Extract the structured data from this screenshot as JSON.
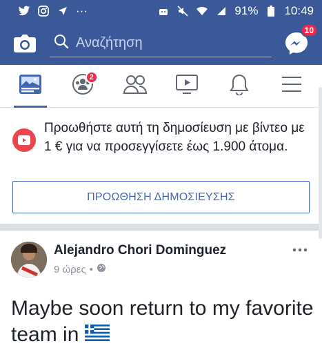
{
  "status_bar": {
    "left_icons": [
      "twitter-icon",
      "instagram-icon",
      "navigation-arrow-icon",
      "more-dots-icon"
    ],
    "battery_percent": "91%",
    "time": "10:49"
  },
  "header": {
    "search_placeholder": "Αναζήτηση",
    "messenger_badge": "10",
    "accent_color": "#3b5998"
  },
  "tabs": [
    {
      "name": "news-feed",
      "icon": "news-feed-icon",
      "active": true
    },
    {
      "name": "groups",
      "icon": "groups-icon",
      "badge": "2"
    },
    {
      "name": "friends",
      "icon": "friends-icon"
    },
    {
      "name": "watch",
      "icon": "video-icon"
    },
    {
      "name": "notifications",
      "icon": "bell-icon"
    },
    {
      "name": "menu",
      "icon": "hamburger-icon"
    }
  ],
  "promo": {
    "text": "Προωθήστε αυτή τη δημοσίευση με βίντεο με 1 € για να προσεγγίσετε έως 1.900 άτομα.",
    "button_label": "ΠΡΟΩΘΗΣΗ ΔΗΜΟΣΙΕΥΣΗΣ"
  },
  "post": {
    "author": "Alejandro Chori Dominguez",
    "time": "9 ώρες",
    "separator": "•",
    "text": "Maybe soon return to my favorite team in"
  }
}
